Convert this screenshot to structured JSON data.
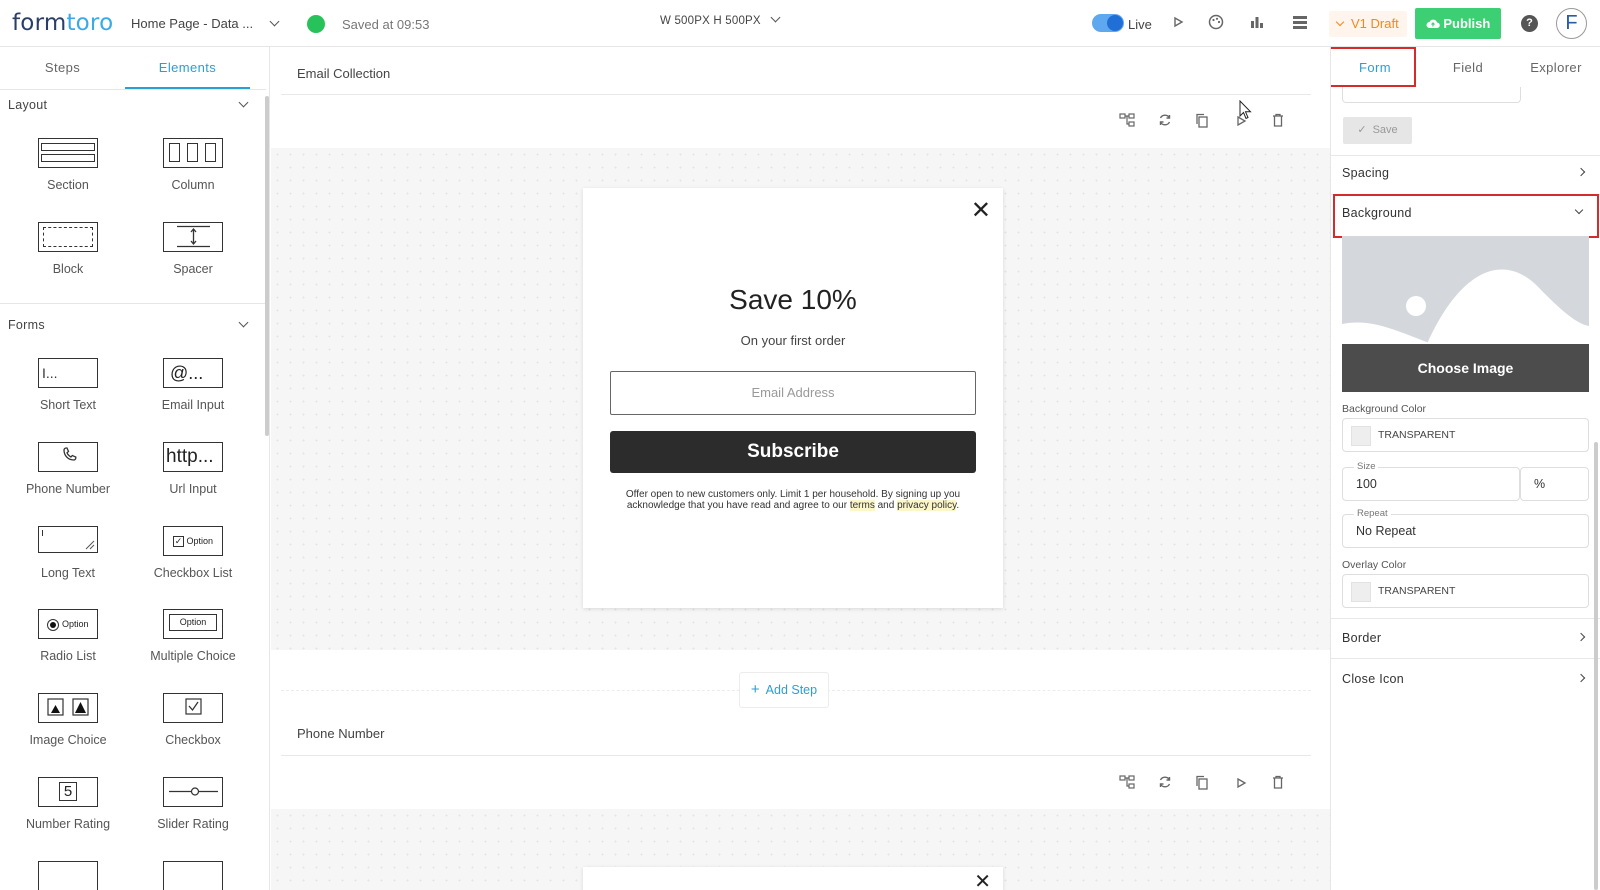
{
  "topbar": {
    "logo_a": "form",
    "logo_b": "toro",
    "page_selector": "Home Page - Data ...",
    "saved_status": "Saved at 09:53",
    "dimensions": "W 500PX  H 500PX",
    "live_label": "Live",
    "draft_label": "V1 Draft",
    "publish_label": "Publish",
    "help_label": "?",
    "avatar_label": "F",
    "status_color": "#27c25a",
    "accent": "#2a9fd6",
    "publish_color": "#3dcf74"
  },
  "left": {
    "tabs": [
      "Steps",
      "Elements"
    ],
    "layout_section": "Layout",
    "forms_section": "Forms",
    "layout_items": [
      "Section",
      "Column",
      "Block",
      "Spacer"
    ],
    "form_items": [
      "Short Text",
      "Email Input",
      "Phone Number",
      "Url Input",
      "Long Text",
      "Checkbox List",
      "Radio List",
      "Multiple Choice",
      "Image Choice",
      "Checkbox",
      "Number Rating",
      "Slider Rating"
    ],
    "icon_text": {
      "short_text": "I...",
      "email": "@...",
      "url": "http...",
      "option": "Option",
      "rating": "5"
    }
  },
  "canvas": {
    "step1_name": "Email Collection",
    "step2_name": "Phone Number",
    "add_step": "Add Step",
    "popup": {
      "title": "Save 10%",
      "subtitle": "On your first order",
      "email_placeholder": "Email Address",
      "subscribe": "Subscribe",
      "fine_print_1": "Offer open to new customers only. Limit 1 per household. By signing up you",
      "fine_print_2": "acknowledge that you have read and agree to our",
      "terms": "terms",
      "and": "and",
      "privacy": "privacy policy",
      "period": "."
    }
  },
  "right": {
    "tabs": [
      "Form",
      "Field",
      "Explorer"
    ],
    "save_label": "Save",
    "spacing": "Spacing",
    "background": "Background",
    "choose_image": "Choose Image",
    "bg_color_label": "Background Color",
    "bg_color_value": "TRANSPARENT",
    "size_label": "Size",
    "size_value": "100",
    "size_unit": "%",
    "repeat_label": "Repeat",
    "repeat_value": "No Repeat",
    "overlay_label": "Overlay Color",
    "overlay_value": "TRANSPARENT",
    "border": "Border",
    "close_icon": "Close Icon",
    "highlight_color": "#d62b2b"
  }
}
